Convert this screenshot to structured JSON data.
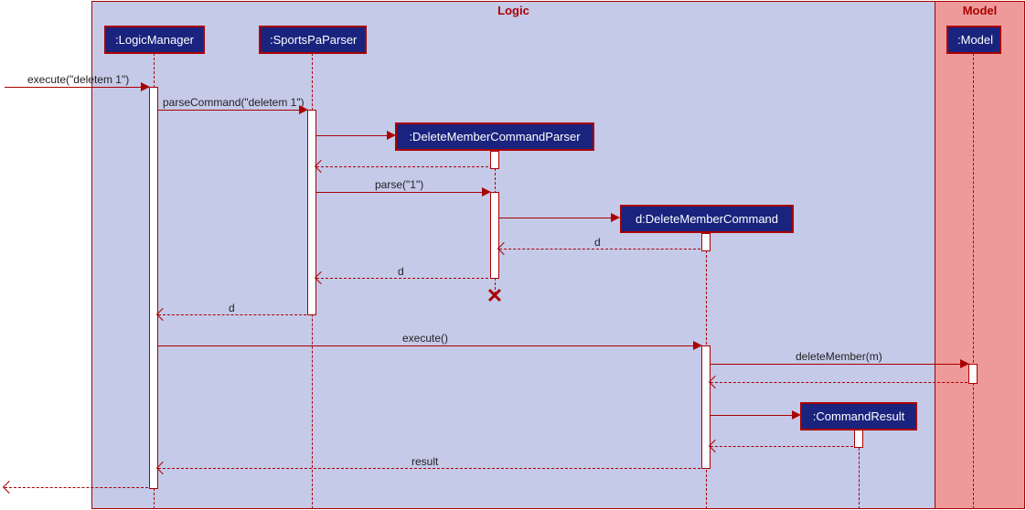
{
  "frames": {
    "logic": "Logic",
    "model": "Model"
  },
  "participants": {
    "logicManager": ":LogicManager",
    "sportsParser": ":SportsPaParser",
    "deleteMemberCommandParser": ":DeleteMemberCommandParser",
    "deleteMemberCommand": "d:DeleteMemberCommand",
    "commandResult": ":CommandResult",
    "model": ":Model"
  },
  "messages": {
    "execute1": "execute(\"deletem 1\")",
    "parseCommand": "parseCommand(\"deletem 1\")",
    "parse1": "parse(\"1\")",
    "d1": "d",
    "d2": "d",
    "d3": "d",
    "execute2": "execute()",
    "deleteMember": "deleteMember(m)",
    "result": "result"
  },
  "chart_data": {
    "type": "sequence_diagram",
    "frames": [
      {
        "name": "Logic",
        "participants": [
          "LogicManager",
          "SportsPaParser",
          "DeleteMemberCommandParser",
          "DeleteMemberCommand",
          "CommandResult"
        ]
      },
      {
        "name": "Model",
        "participants": [
          "Model"
        ]
      }
    ],
    "lifelines": [
      {
        "id": "LogicManager",
        "label": ":LogicManager",
        "created_at_start": true
      },
      {
        "id": "SportsPaParser",
        "label": ":SportsPaParser",
        "created_at_start": true
      },
      {
        "id": "DeleteMemberCommandParser",
        "label": ":DeleteMemberCommandParser",
        "created_by": "SportsPaParser",
        "destroyed": true
      },
      {
        "id": "DeleteMemberCommand",
        "label": "d:DeleteMemberCommand",
        "created_by": "DeleteMemberCommandParser"
      },
      {
        "id": "CommandResult",
        "label": ":CommandResult",
        "created_by": "DeleteMemberCommand"
      },
      {
        "id": "Model",
        "label": ":Model",
        "created_at_start": true
      }
    ],
    "messages": [
      {
        "from": "external",
        "to": "LogicManager",
        "label": "execute(\"deletem 1\")",
        "type": "sync"
      },
      {
        "from": "LogicManager",
        "to": "SportsPaParser",
        "label": "parseCommand(\"deletem 1\")",
        "type": "sync"
      },
      {
        "from": "SportsPaParser",
        "to": "DeleteMemberCommandParser",
        "label": "",
        "type": "create"
      },
      {
        "from": "DeleteMemberCommandParser",
        "to": "SportsPaParser",
        "label": "",
        "type": "return"
      },
      {
        "from": "SportsPaParser",
        "to": "DeleteMemberCommandParser",
        "label": "parse(\"1\")",
        "type": "sync"
      },
      {
        "from": "DeleteMemberCommandParser",
        "to": "DeleteMemberCommand",
        "label": "",
        "type": "create"
      },
      {
        "from": "DeleteMemberCommand",
        "to": "DeleteMemberCommandParser",
        "label": "d",
        "type": "return"
      },
      {
        "from": "DeleteMemberCommandParser",
        "to": "SportsPaParser",
        "label": "d",
        "type": "return"
      },
      {
        "from": "DeleteMemberCommandParser",
        "type": "destroy"
      },
      {
        "from": "SportsPaParser",
        "to": "LogicManager",
        "label": "d",
        "type": "return"
      },
      {
        "from": "LogicManager",
        "to": "DeleteMemberCommand",
        "label": "execute()",
        "type": "sync"
      },
      {
        "from": "DeleteMemberCommand",
        "to": "Model",
        "label": "deleteMember(m)",
        "type": "sync"
      },
      {
        "from": "Model",
        "to": "DeleteMemberCommand",
        "label": "",
        "type": "return"
      },
      {
        "from": "DeleteMemberCommand",
        "to": "CommandResult",
        "label": "",
        "type": "create"
      },
      {
        "from": "CommandResult",
        "to": "DeleteMemberCommand",
        "label": "",
        "type": "return"
      },
      {
        "from": "DeleteMemberCommand",
        "to": "LogicManager",
        "label": "result",
        "type": "return"
      },
      {
        "from": "LogicManager",
        "to": "external",
        "label": "",
        "type": "return"
      }
    ]
  }
}
